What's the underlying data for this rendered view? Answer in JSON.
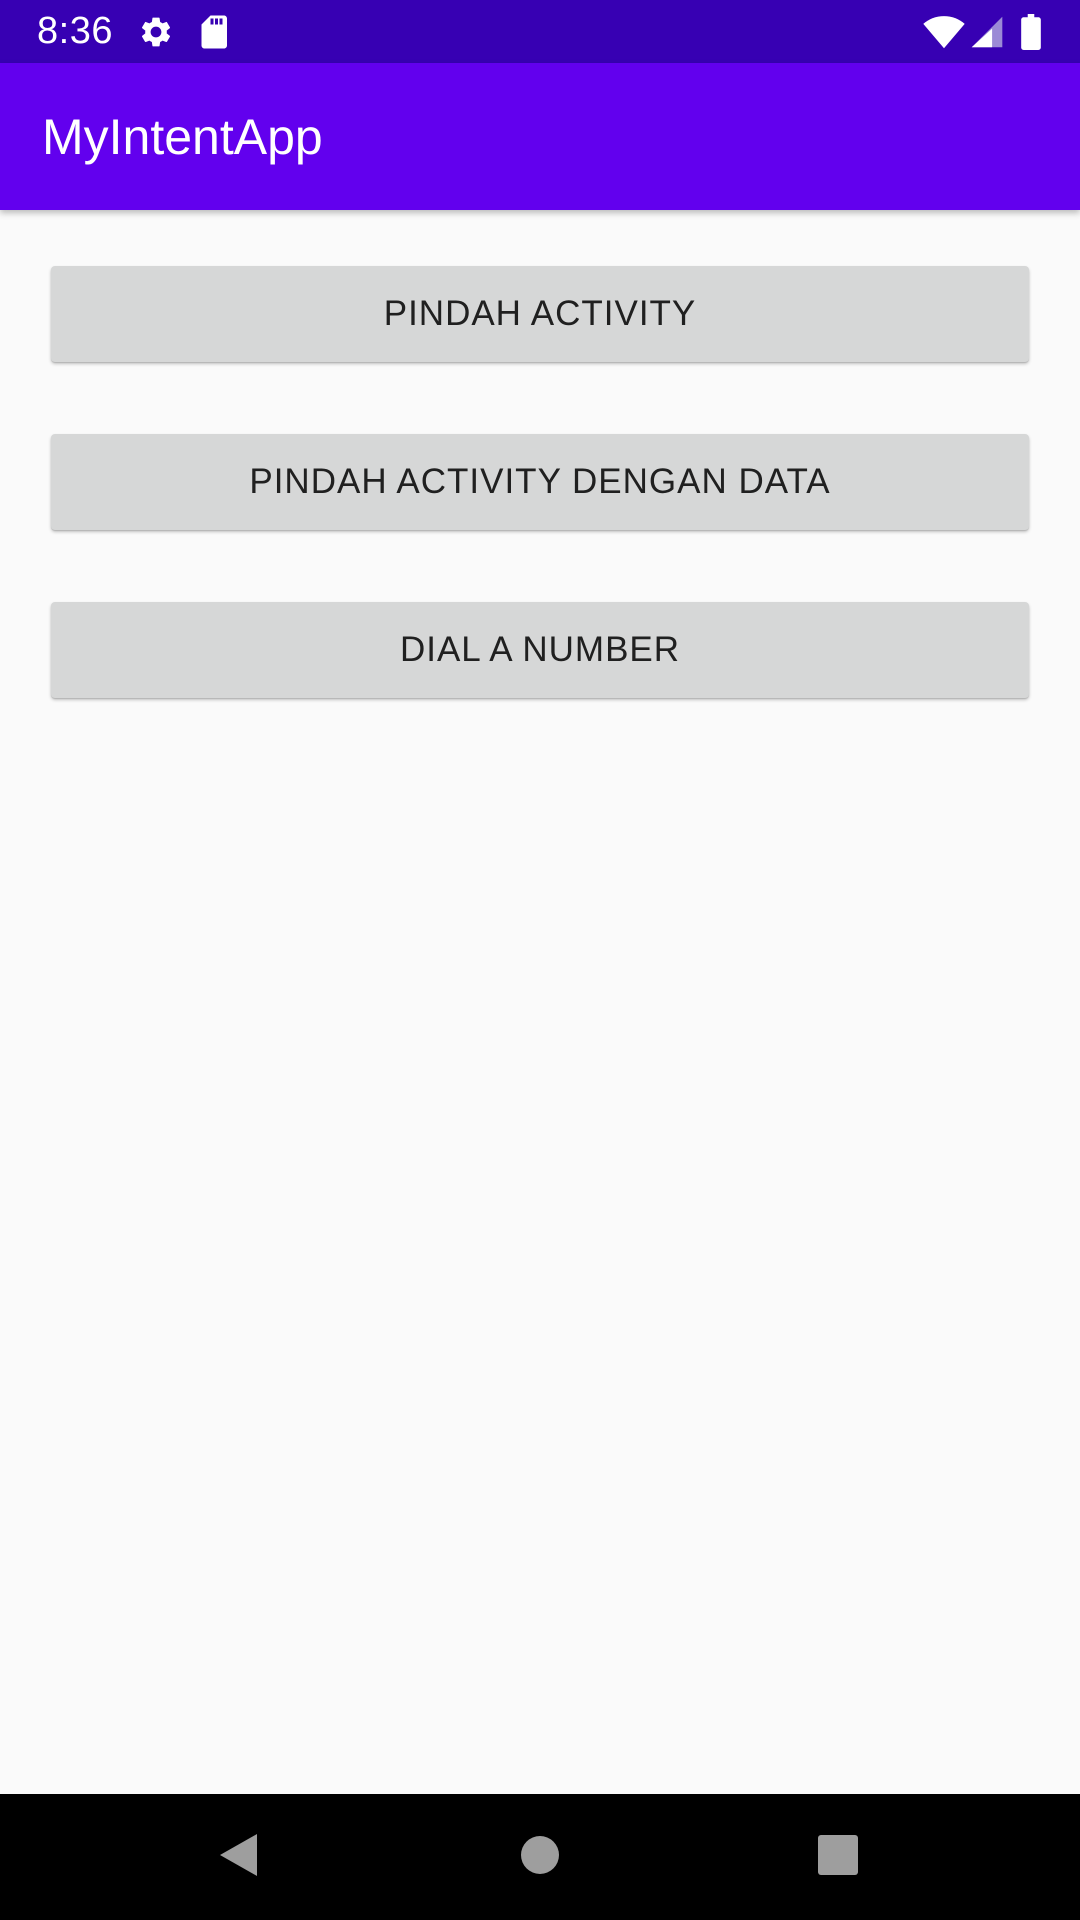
{
  "status_bar": {
    "time": "8:36",
    "icons": [
      "settings-icon",
      "sd-card-icon",
      "wifi-icon",
      "cell-signal-icon",
      "battery-icon"
    ],
    "background": "#3700b3"
  },
  "app_bar": {
    "title": "MyIntentApp",
    "background": "#6200ee"
  },
  "buttons": [
    {
      "label": "PINDAH ACTIVITY"
    },
    {
      "label": "PINDAH ACTIVITY DENGAN DATA"
    },
    {
      "label": "DIAL A NUMBER"
    }
  ],
  "nav_bar": {
    "icons": [
      "back-icon",
      "home-icon",
      "recents-icon"
    ],
    "icon_color": "#9e9e9e"
  }
}
